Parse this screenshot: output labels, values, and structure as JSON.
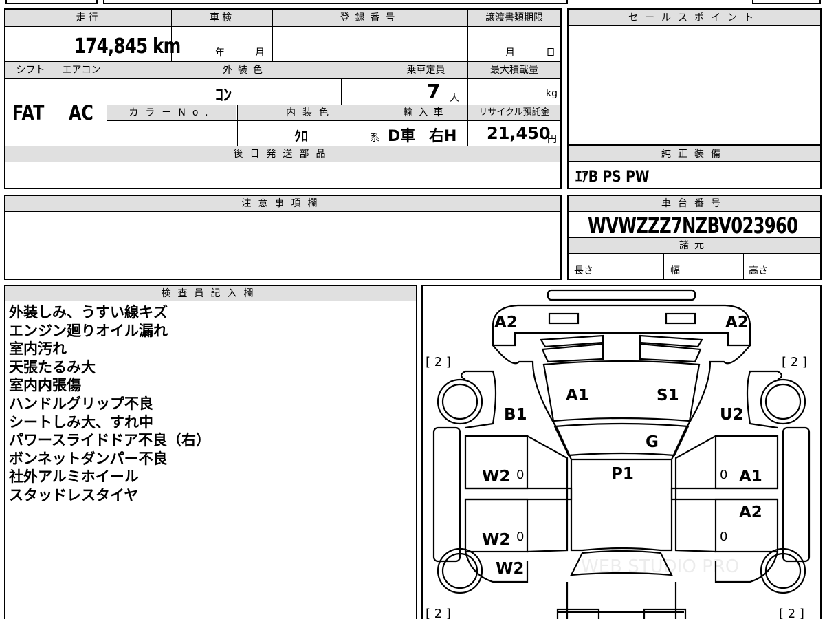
{
  "top": {
    "mileage_label": "走行",
    "mileage_value": "174,845 km",
    "inspection_label": "車検",
    "inspection_year": "年",
    "inspection_month": "月",
    "registration_label": "登録番号",
    "transfer_deadline_label": "譲渡書類期限",
    "transfer_month": "月",
    "transfer_day": "日",
    "shift_label": "シフト",
    "shift_value": "FAT",
    "aircon_label": "エアコン",
    "aircon_value": "AC",
    "exterior_color_label": "外装色",
    "exterior_color_value": "ｺﾝ",
    "capacity_label": "乗車定員",
    "capacity_value": "7",
    "capacity_unit": "人",
    "max_load_label": "最大積載量",
    "max_load_unit": "kg",
    "color_no_label": "カラーNo.",
    "interior_color_label": "内装色",
    "interior_color_value": "ｸﾛ",
    "interior_color_suffix": "系",
    "import_label": "輸入車",
    "import_type": "D車",
    "steering": "右H",
    "recycle_label": "リサイクル預託金",
    "recycle_value": "21,450",
    "recycle_unit": "円",
    "later_parts_label": "後日発送部品"
  },
  "sales_point": {
    "label": "セールスポイント"
  },
  "factory_equipment": {
    "label": "純正装備",
    "value": "ｴｱB PS PW"
  },
  "notes": {
    "label": "注意事項欄"
  },
  "chassis": {
    "label": "車台番号",
    "value": "WVWZZZ7NZBV023960",
    "specs_label": "諸元",
    "length_label": "長さ",
    "width_label": "幅",
    "height_label": "高さ"
  },
  "inspector": {
    "label": "検査員記入欄",
    "remarks": [
      "外装しみ、うすい線キズ",
      "エンジン廻りオイル漏れ",
      "室内汚れ",
      "天張たるみ大",
      "室内内張傷",
      "ハンドルグリップ不良",
      "シートしみ大、すれ中",
      "パワースライドドア不良（右）",
      "ボンネットダンパー不良",
      "社外アルミホイール",
      "スタッドレスタイヤ"
    ]
  },
  "diagram": {
    "front_left_corner": "A2",
    "front_right_corner": "A2",
    "front_left_tire": "[ 2 ]",
    "front_right_tire": "[ 2 ]",
    "rear_left_tire": "[ 2 ]",
    "rear_right_tire": "[ 2 ]",
    "hood_left": "A1",
    "hood_right": "S1",
    "left_fender": "B1",
    "right_fender": "U2",
    "windshield": "G",
    "roof": "P1",
    "left_front_door": "W2",
    "left_rear_door": "W2",
    "left_rear_quarter": "W2",
    "right_front_door_1": "A1",
    "right_rear_door": "A2",
    "door_mark": "0",
    "watermark": "WEB STUDIO PRO"
  }
}
